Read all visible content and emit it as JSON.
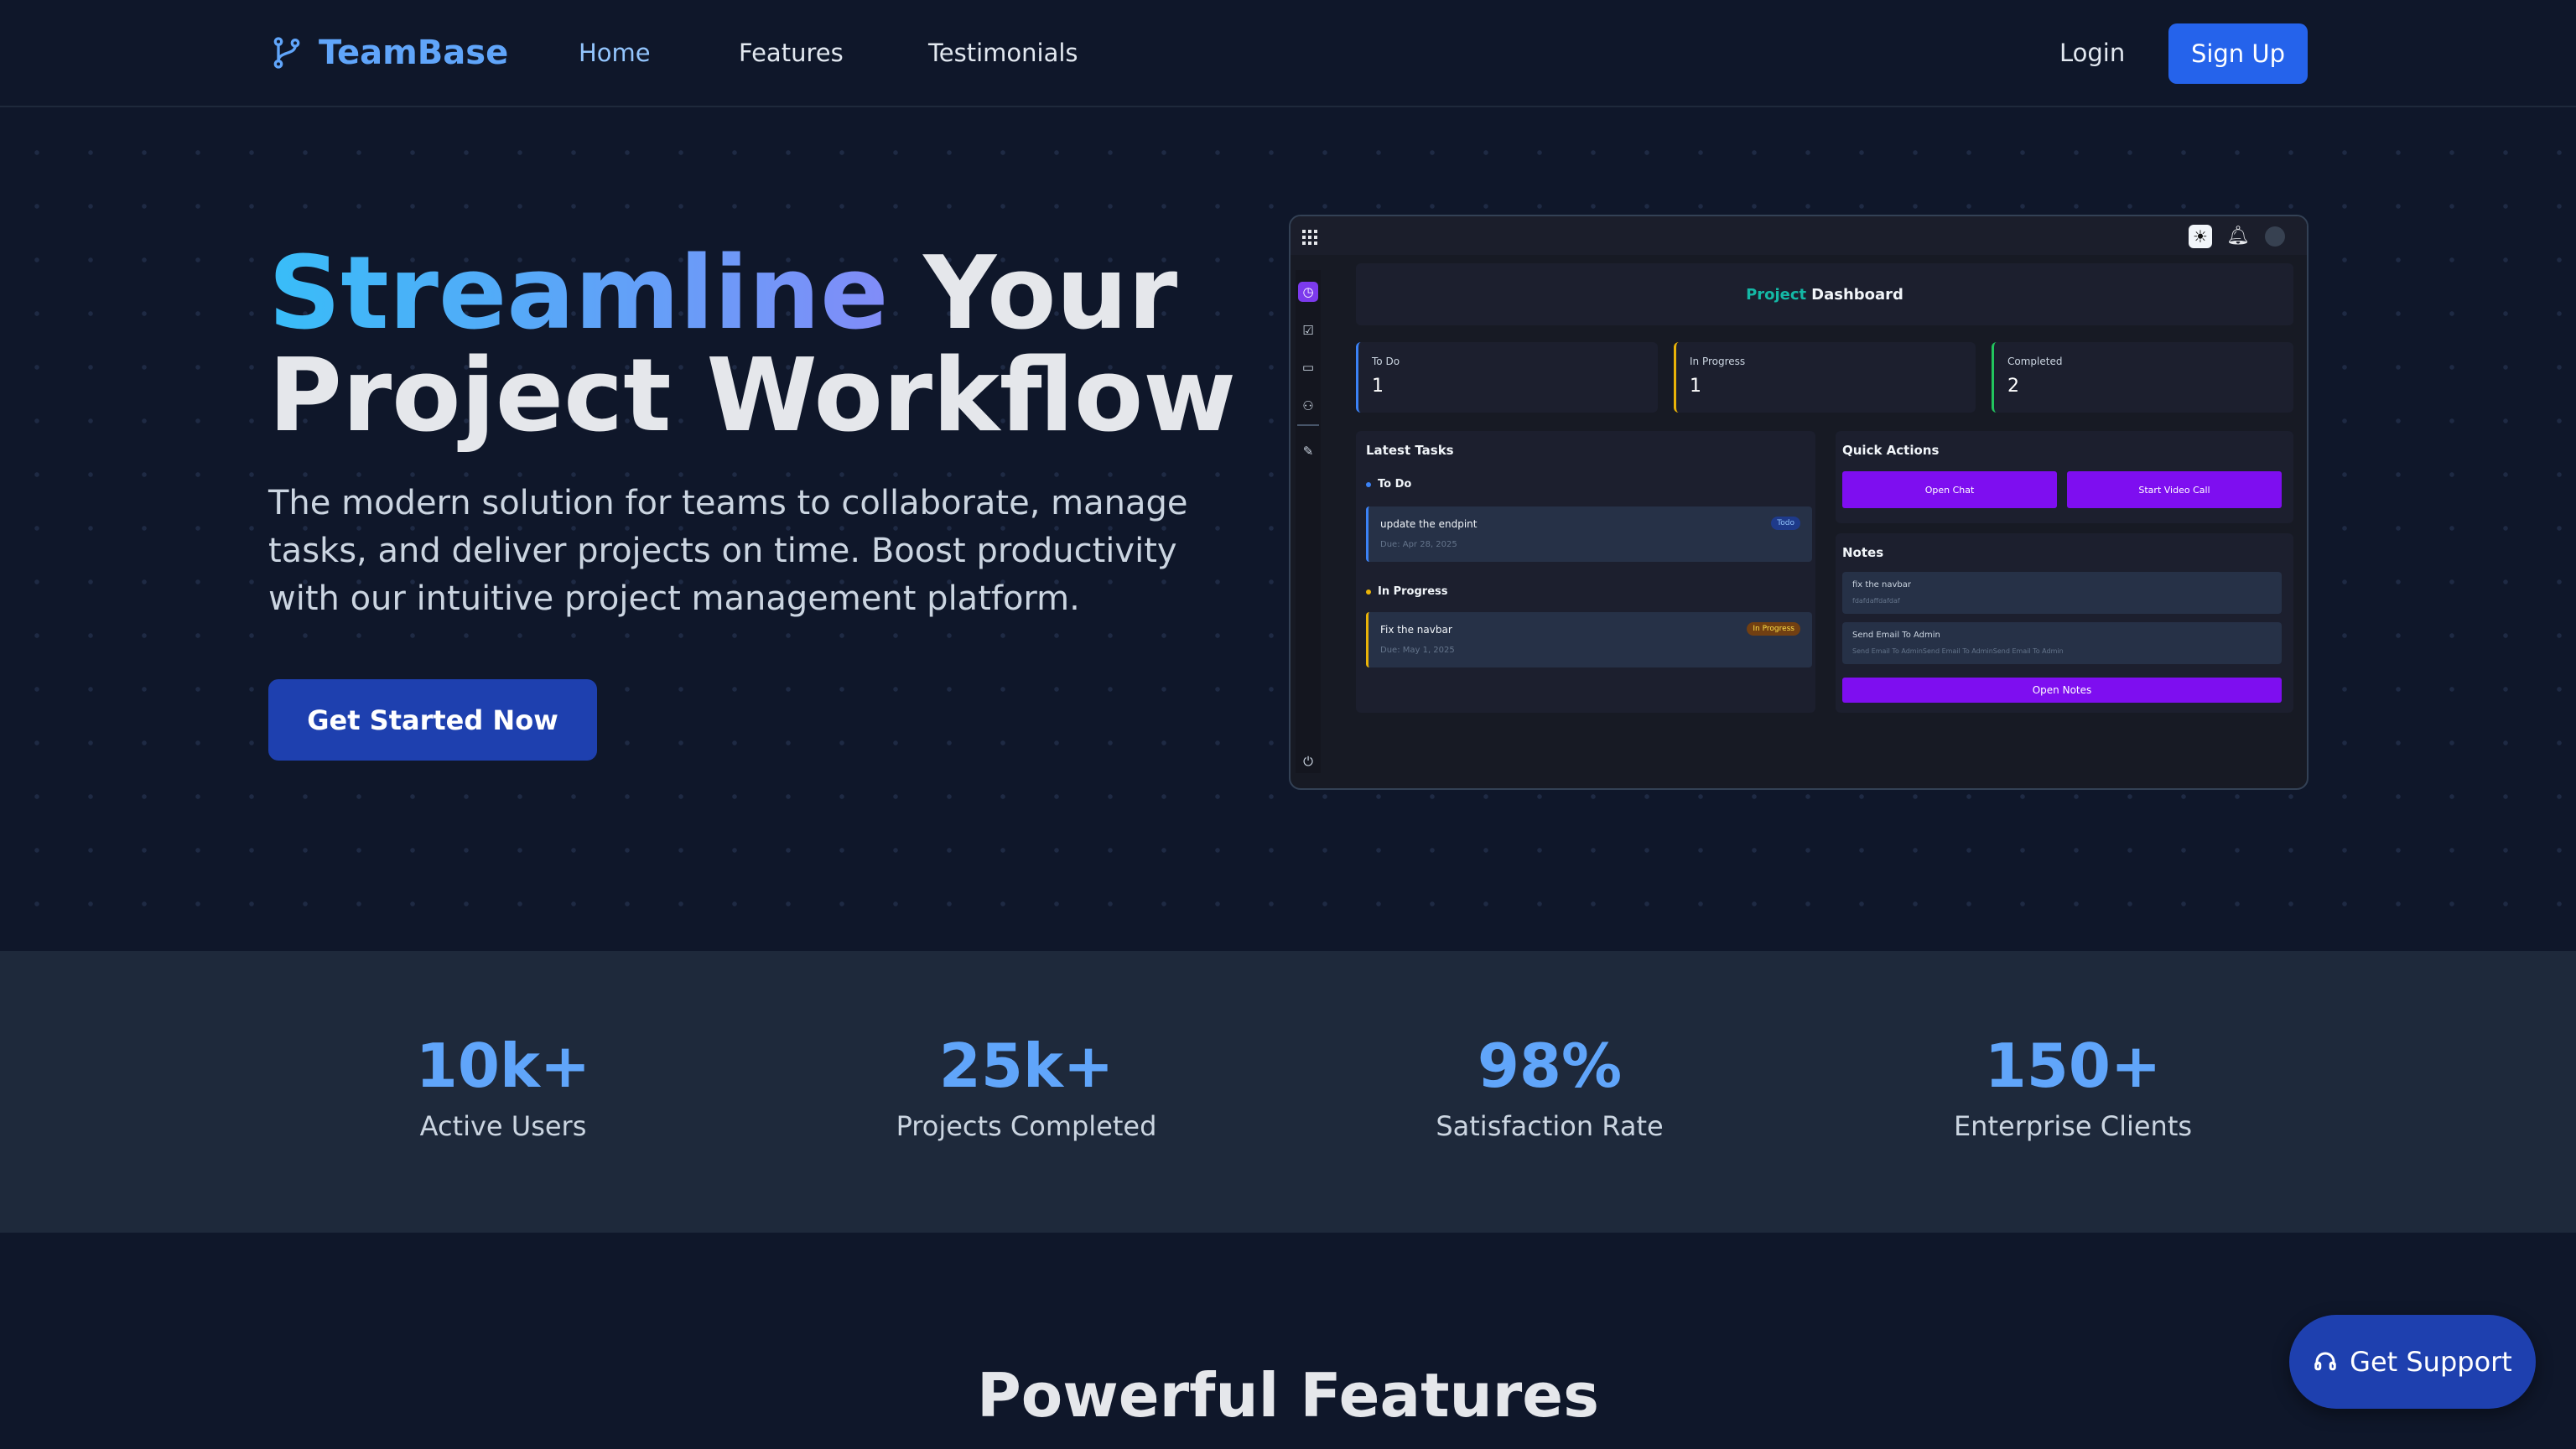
{
  "nav": {
    "brand": "TeamBase",
    "links": [
      "Home",
      "Features",
      "Testimonials"
    ],
    "login": "Login",
    "signup": "Sign Up"
  },
  "hero": {
    "title_highlight": "Streamline",
    "title_rest_line1": " Your",
    "title_line2": "Project Workflow",
    "subtitle": "The modern solution for teams to collaborate, manage tasks, and deliver projects on time. Boost productivity with our intuitive project management platform.",
    "cta": "Get Started Now"
  },
  "dashboard": {
    "title_accent": "Project",
    "title_rest": "Dashboard",
    "stats": [
      {
        "label": "To Do",
        "value": "1",
        "color": "#3b82f6"
      },
      {
        "label": "In Progress",
        "value": "1",
        "color": "#eab308"
      },
      {
        "label": "Completed",
        "value": "2",
        "color": "#22c55e"
      }
    ],
    "latest_tasks": {
      "heading": "Latest Tasks",
      "todo_heading": "To Do",
      "todo_task": {
        "title": "update the endpint",
        "due": "Due: Apr 28, 2025",
        "badge": "Todo"
      },
      "progress_heading": "In Progress",
      "progress_task": {
        "title": "Fix the navbar",
        "due": "Due: May 1, 2025",
        "badge": "In Progress"
      }
    },
    "quick_actions": {
      "heading": "Quick Actions",
      "open_chat": "Open Chat",
      "start_video": "Start Video Call"
    },
    "notes": {
      "heading": "Notes",
      "items": [
        {
          "title": "fix the navbar",
          "body": "fdafdaffdafdaf"
        },
        {
          "title": "Send Email To Admin",
          "body": "Send Email To AdminSend Email To AdminSend Email To Admin"
        }
      ],
      "open_notes": "Open Notes"
    }
  },
  "stats": [
    {
      "value": "10k+",
      "label": "Active Users"
    },
    {
      "value": "25k+",
      "label": "Projects Completed"
    },
    {
      "value": "98%",
      "label": "Satisfaction Rate"
    },
    {
      "value": "150+",
      "label": "Enterprise Clients"
    }
  ],
  "features": {
    "title": "Powerful Features"
  },
  "support": {
    "label": "Get Support"
  },
  "colors": {
    "accent": "#2563eb",
    "brand": "#60a5fa",
    "purple": "#7e0ef0",
    "teal": "#14b8a6"
  }
}
